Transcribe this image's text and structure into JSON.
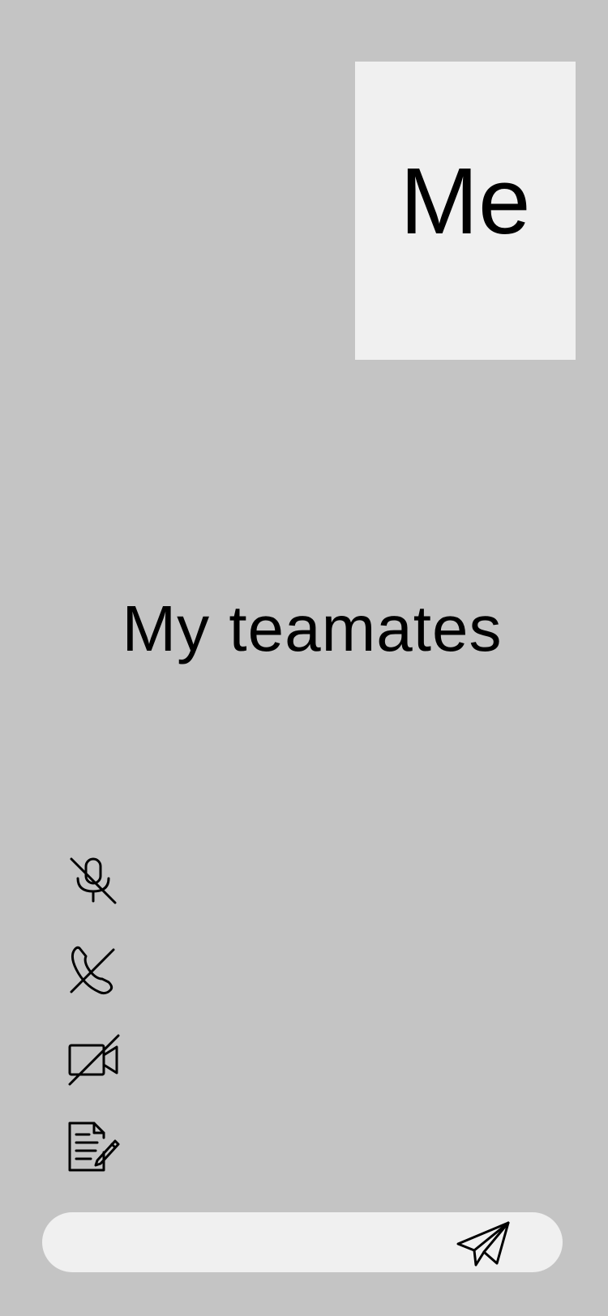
{
  "self_tile": {
    "label": "Me"
  },
  "teammates": {
    "label": "My teamates"
  },
  "controls": [
    {
      "icon": "microphone-muted-icon"
    },
    {
      "icon": "phone-off-icon"
    },
    {
      "icon": "video-off-icon"
    },
    {
      "icon": "document-edit-icon"
    }
  ],
  "message_bar": {
    "value": "",
    "send_icon": "paper-plane-icon"
  },
  "colors": {
    "background": "#c4c4c4",
    "tile": "#f0f0f0",
    "text": "#000000"
  }
}
